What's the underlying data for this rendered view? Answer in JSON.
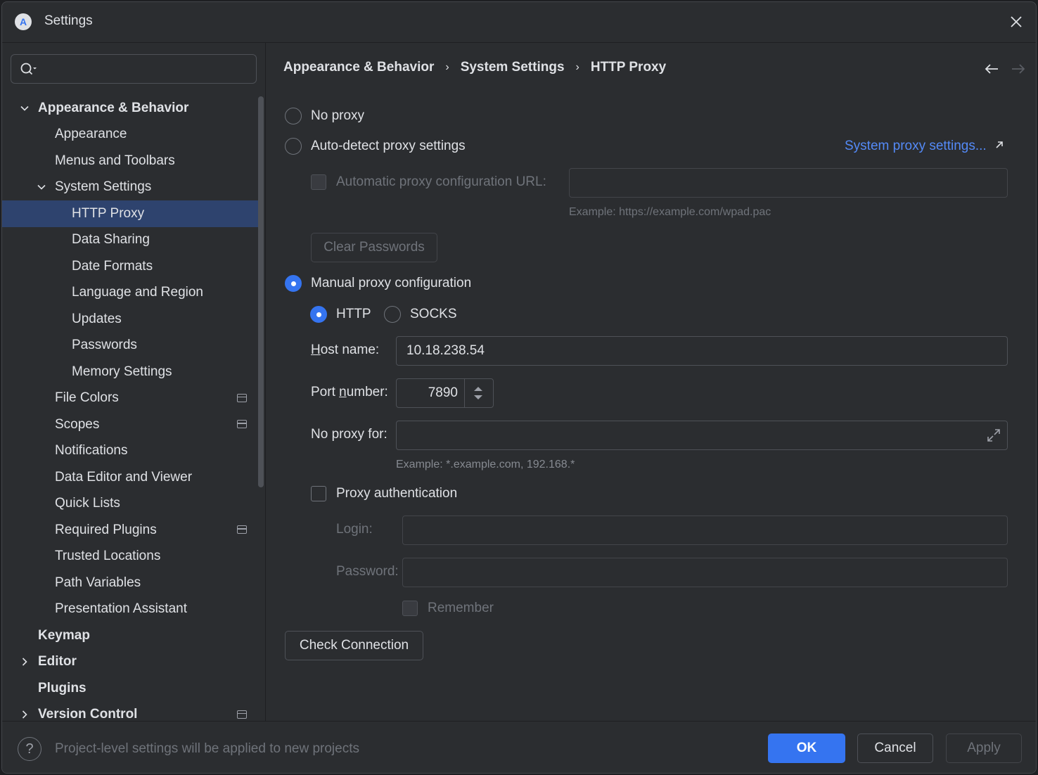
{
  "window": {
    "title": "Settings",
    "app_icon_letter": "A"
  },
  "search": {
    "placeholder": "",
    "value": ""
  },
  "sidebar": {
    "items": [
      {
        "label": "Appearance & Behavior"
      },
      {
        "label": "Appearance"
      },
      {
        "label": "Menus and Toolbars"
      },
      {
        "label": "System Settings"
      },
      {
        "label": "HTTP Proxy"
      },
      {
        "label": "Data Sharing"
      },
      {
        "label": "Date Formats"
      },
      {
        "label": "Language and Region"
      },
      {
        "label": "Updates"
      },
      {
        "label": "Passwords"
      },
      {
        "label": "Memory Settings"
      },
      {
        "label": "File Colors"
      },
      {
        "label": "Scopes"
      },
      {
        "label": "Notifications"
      },
      {
        "label": "Data Editor and Viewer"
      },
      {
        "label": "Quick Lists"
      },
      {
        "label": "Required Plugins"
      },
      {
        "label": "Trusted Locations"
      },
      {
        "label": "Path Variables"
      },
      {
        "label": "Presentation Assistant"
      },
      {
        "label": "Keymap"
      },
      {
        "label": "Editor"
      },
      {
        "label": "Plugins"
      },
      {
        "label": "Version Control"
      }
    ]
  },
  "breadcrumb": {
    "items": [
      "Appearance & Behavior",
      "System Settings",
      "HTTP Proxy"
    ],
    "separator": "›"
  },
  "proxy": {
    "no_proxy_label": "No proxy",
    "auto_detect_label": "Auto-detect proxy settings",
    "system_proxy_link": "System proxy settings...",
    "auto_config_url_label": "Automatic proxy configuration URL:",
    "auto_config_url_value": "",
    "auto_config_example": "Example: https://example.com/wpad.pac",
    "clear_passwords_label": "Clear Passwords",
    "manual_label": "Manual proxy configuration",
    "http_label": "HTTP",
    "socks_label": "SOCKS",
    "host_label_prefix": "H",
    "host_label_rest": "ost name:",
    "host_value": "10.18.238.54",
    "port_label_prefix": "Port ",
    "port_label_u": "n",
    "port_label_rest": "umber:",
    "port_value": "7890",
    "no_proxy_for_label": "No proxy for:",
    "no_proxy_for_value": "",
    "no_proxy_example": "Example: *.example.com, 192.168.*",
    "auth_label": "Proxy authentication",
    "login_label": "Login:",
    "login_value": "",
    "password_label": "Password:",
    "password_value": "",
    "remember_label": "Remember",
    "check_connection_label": "Check Connection",
    "selected_mode": "manual",
    "selected_protocol": "HTTP"
  },
  "footer": {
    "help_glyph": "?",
    "hint": "Project-level settings will be applied to new projects",
    "ok_label": "OK",
    "cancel_label": "Cancel",
    "apply_label": "Apply"
  },
  "colors": {
    "accent": "#3574f0",
    "link": "#548af7",
    "selected_row": "#2e436e",
    "background": "#2b2d30"
  }
}
